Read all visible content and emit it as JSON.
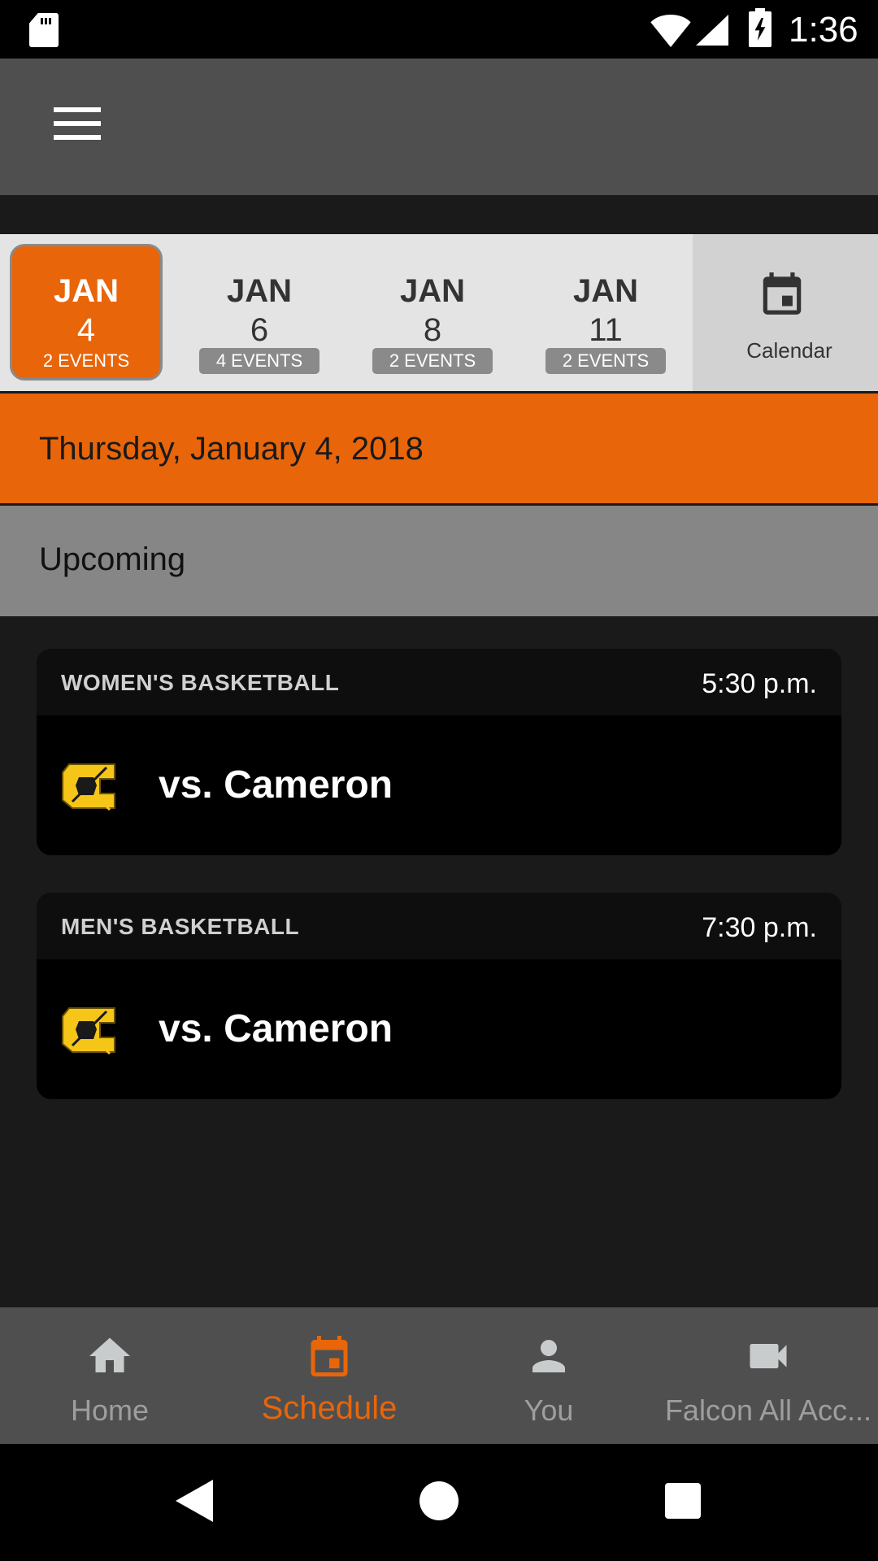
{
  "status_bar": {
    "time": "1:36"
  },
  "date_strip": {
    "dates": [
      {
        "month": "JAN",
        "day": "4",
        "events": "2 EVENTS",
        "selected": true
      },
      {
        "month": "JAN",
        "day": "6",
        "events": "4 EVENTS",
        "selected": false
      },
      {
        "month": "JAN",
        "day": "8",
        "events": "2 EVENTS",
        "selected": false
      },
      {
        "month": "JAN",
        "day": "11",
        "events": "2 EVENTS",
        "selected": false
      }
    ],
    "calendar_label": "Calendar"
  },
  "selected_date": "Thursday, January 4, 2018",
  "section_title": "Upcoming",
  "events": [
    {
      "sport": "WOMEN'S BASKETBALL",
      "time": "5:30 p.m.",
      "opponent": "vs. Cameron"
    },
    {
      "sport": "MEN'S BASKETBALL",
      "time": "7:30 p.m.",
      "opponent": "vs. Cameron"
    }
  ],
  "bottom_nav": [
    {
      "label": "Home",
      "icon": "home-icon",
      "active": false
    },
    {
      "label": "Schedule",
      "icon": "calendar-icon",
      "active": true
    },
    {
      "label": "You",
      "icon": "person-icon",
      "active": false
    },
    {
      "label": "Falcon All Acc...",
      "icon": "video-camera-icon",
      "active": false
    }
  ],
  "colors": {
    "accent": "#e8650a",
    "app_bar": "#4f4f4f",
    "badge": "#8a8a8a",
    "logo_gold": "#f5c518"
  }
}
